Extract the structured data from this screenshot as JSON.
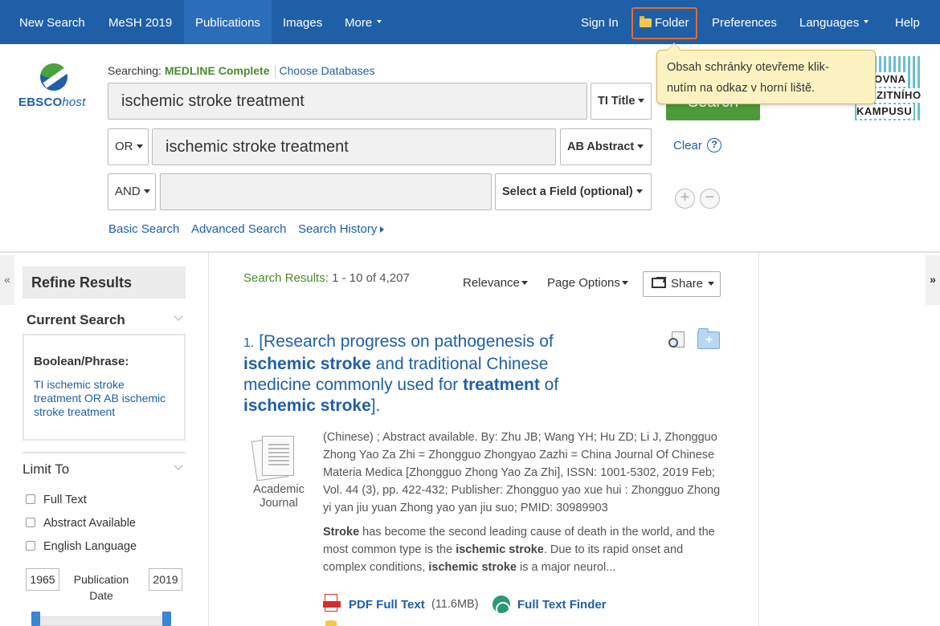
{
  "topnav": {
    "items": [
      "New Search",
      "MeSH 2019",
      "Publications",
      "Images",
      "More"
    ],
    "right_items": [
      "Sign In",
      "Folder",
      "Preferences",
      "Languages",
      "Help"
    ]
  },
  "tooltip": {
    "line1": "Obsah schránky otevřeme klik-",
    "line2": "nutím na odkaz v horní liště."
  },
  "logo": {
    "ebsco": "EBSCO",
    "host": "host"
  },
  "univ_logo": {
    "line1": "OVNA",
    "line2": "ERZITNÍHO",
    "line3": "KAMPUSU"
  },
  "search": {
    "searching_label": "Searching:",
    "database": "MEDLINE Complete",
    "choose_databases": "Choose Databases",
    "rows": [
      {
        "operator": "",
        "query": "ischemic stroke treatment",
        "field": "TI Title"
      },
      {
        "operator": "OR",
        "query": "ischemic stroke treatment",
        "field": "AB Abstract"
      },
      {
        "operator": "AND",
        "query": "",
        "field": "Select a Field (optional)"
      }
    ],
    "search_button": "Search",
    "clear": "Clear",
    "help": "?",
    "basic_search": "Basic Search",
    "advanced_search": "Advanced Search",
    "search_history": "Search History"
  },
  "sidebar": {
    "refine_title": "Refine Results",
    "current_search": "Current Search",
    "boolean_label": "Boolean/Phrase:",
    "boolean_value": "TI ischemic stroke treatment OR AB ischemic stroke treatment",
    "limit_to": "Limit To",
    "limits": [
      "Full Text",
      "Abstract Available",
      "English Language"
    ],
    "year_from": "1965",
    "year_to": "2019",
    "pub_date_label": "Publication Date"
  },
  "results": {
    "count_label": "Search Results:",
    "count_value": "1 - 10 of 4,207",
    "relevance": "Relevance",
    "page_options": "Page Options",
    "share": "Share",
    "items": [
      {
        "number": "1.",
        "title_parts": [
          {
            "t": "[Research progress on pathogenesis of ",
            "b": false
          },
          {
            "t": "ischemic stroke",
            "b": true
          },
          {
            "t": " and traditional Chinese medicine commonly used for ",
            "b": false
          },
          {
            "t": "treatment",
            "b": true
          },
          {
            "t": " of ",
            "b": false
          },
          {
            "t": "ischemic stroke",
            "b": true
          },
          {
            "t": "].",
            "b": false
          }
        ],
        "doc_type": "Academic Journal",
        "meta": "(Chinese) ; Abstract available. By: Zhu JB; Wang YH; Hu ZD; Li J, Zhongguo Zhong Yao Za Zhi = Zhongguo Zhongyao Zazhi = China Journal Of Chinese Materia Medica [Zhongguo Zhong Yao Za Zhi], ISSN: 1001-5302, 2019 Feb; Vol. 44 (3), pp. 422-432; Publisher: Zhongguo yao xue hui : Zhongguo Zhong yi yan jiu yuan Zhong yao yan jiu suo; PMID: 30989903",
        "abstract_parts": [
          {
            "t": "Stroke",
            "b": true
          },
          {
            "t": " has become the second leading cause of death in the world, and the most common type is the ",
            "b": false
          },
          {
            "t": "ischemic stroke",
            "b": true
          },
          {
            "t": ". Due to its rapid onset and complex conditions, ",
            "b": false
          },
          {
            "t": "ischemic stroke",
            "b": true
          },
          {
            "t": " is a major neurol...",
            "b": false
          }
        ],
        "pdf_link": "PDF Full Text",
        "pdf_size": "(11.6MB)",
        "full_text_finder": "Full Text Finder"
      }
    ]
  },
  "colors": {
    "nav_bg": "#1f5fa8",
    "link": "#1f5fa8",
    "green": "#4b9b3a",
    "highlight_border": "#e36c2a",
    "tooltip_bg": "#fdf3c2"
  }
}
